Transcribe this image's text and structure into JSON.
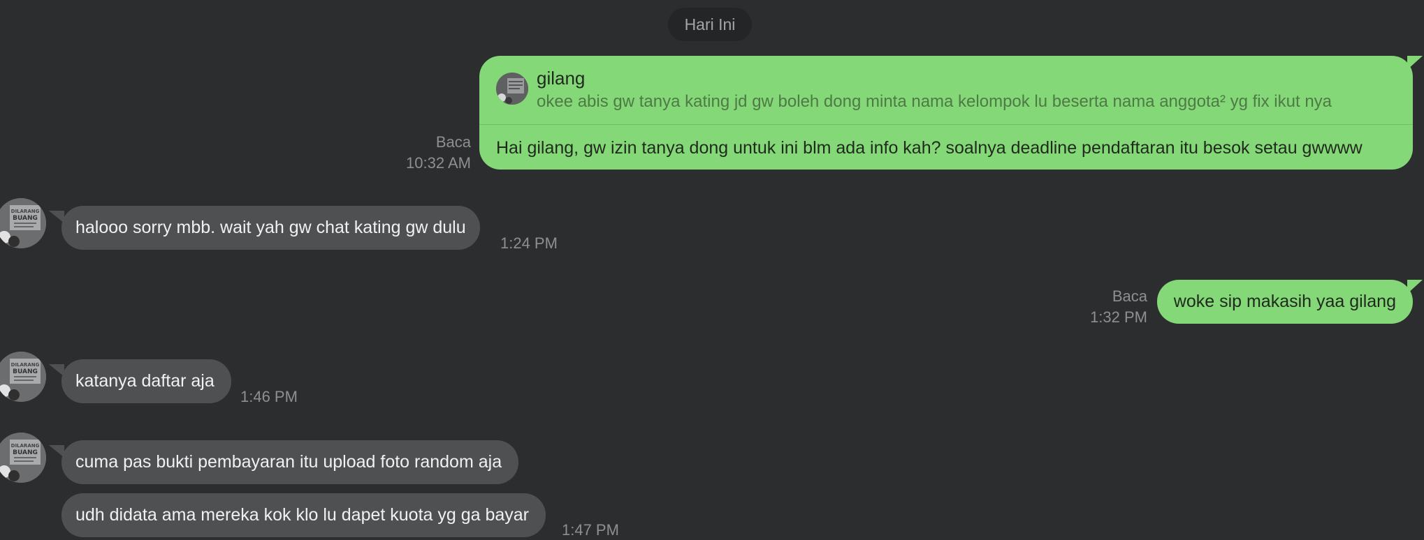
{
  "date_separator": "Hari Ini",
  "messages": [
    {
      "direction": "out",
      "reply_to": {
        "name": "gilang",
        "text": "okee abis gw tanya kating jd gw boleh dong minta nama kelompok lu beserta nama anggota² yg fix ikut nya"
      },
      "text": "Hai gilang, gw izin tanya dong untuk ini blm ada info kah? soalnya deadline pendaftaran itu besok setau gwwww",
      "status": "Baca",
      "time": "10:32 AM"
    },
    {
      "direction": "in",
      "text": "halooo sorry mbb. wait yah gw chat kating gw dulu",
      "time": "1:24 PM"
    },
    {
      "direction": "out",
      "text": "woke sip makasih yaa gilang",
      "status": "Baca",
      "time": "1:32 PM"
    },
    {
      "direction": "in",
      "text": "katanya daftar aja",
      "time": "1:46 PM"
    },
    {
      "direction": "in",
      "text": "cuma pas bukti pembayaran itu upload foto random aja",
      "time": ""
    },
    {
      "direction": "in",
      "text": "udh didata ama mereka kok klo lu dapet kuota yg ga bayar",
      "time": "1:47 PM"
    }
  ],
  "avatar_text": "DILARANG BUANG",
  "colors": {
    "background": "#2c2d2f",
    "outgoing_bubble": "#85d877",
    "incoming_bubble": "#4f5052",
    "meta_text": "#8e8f91"
  }
}
